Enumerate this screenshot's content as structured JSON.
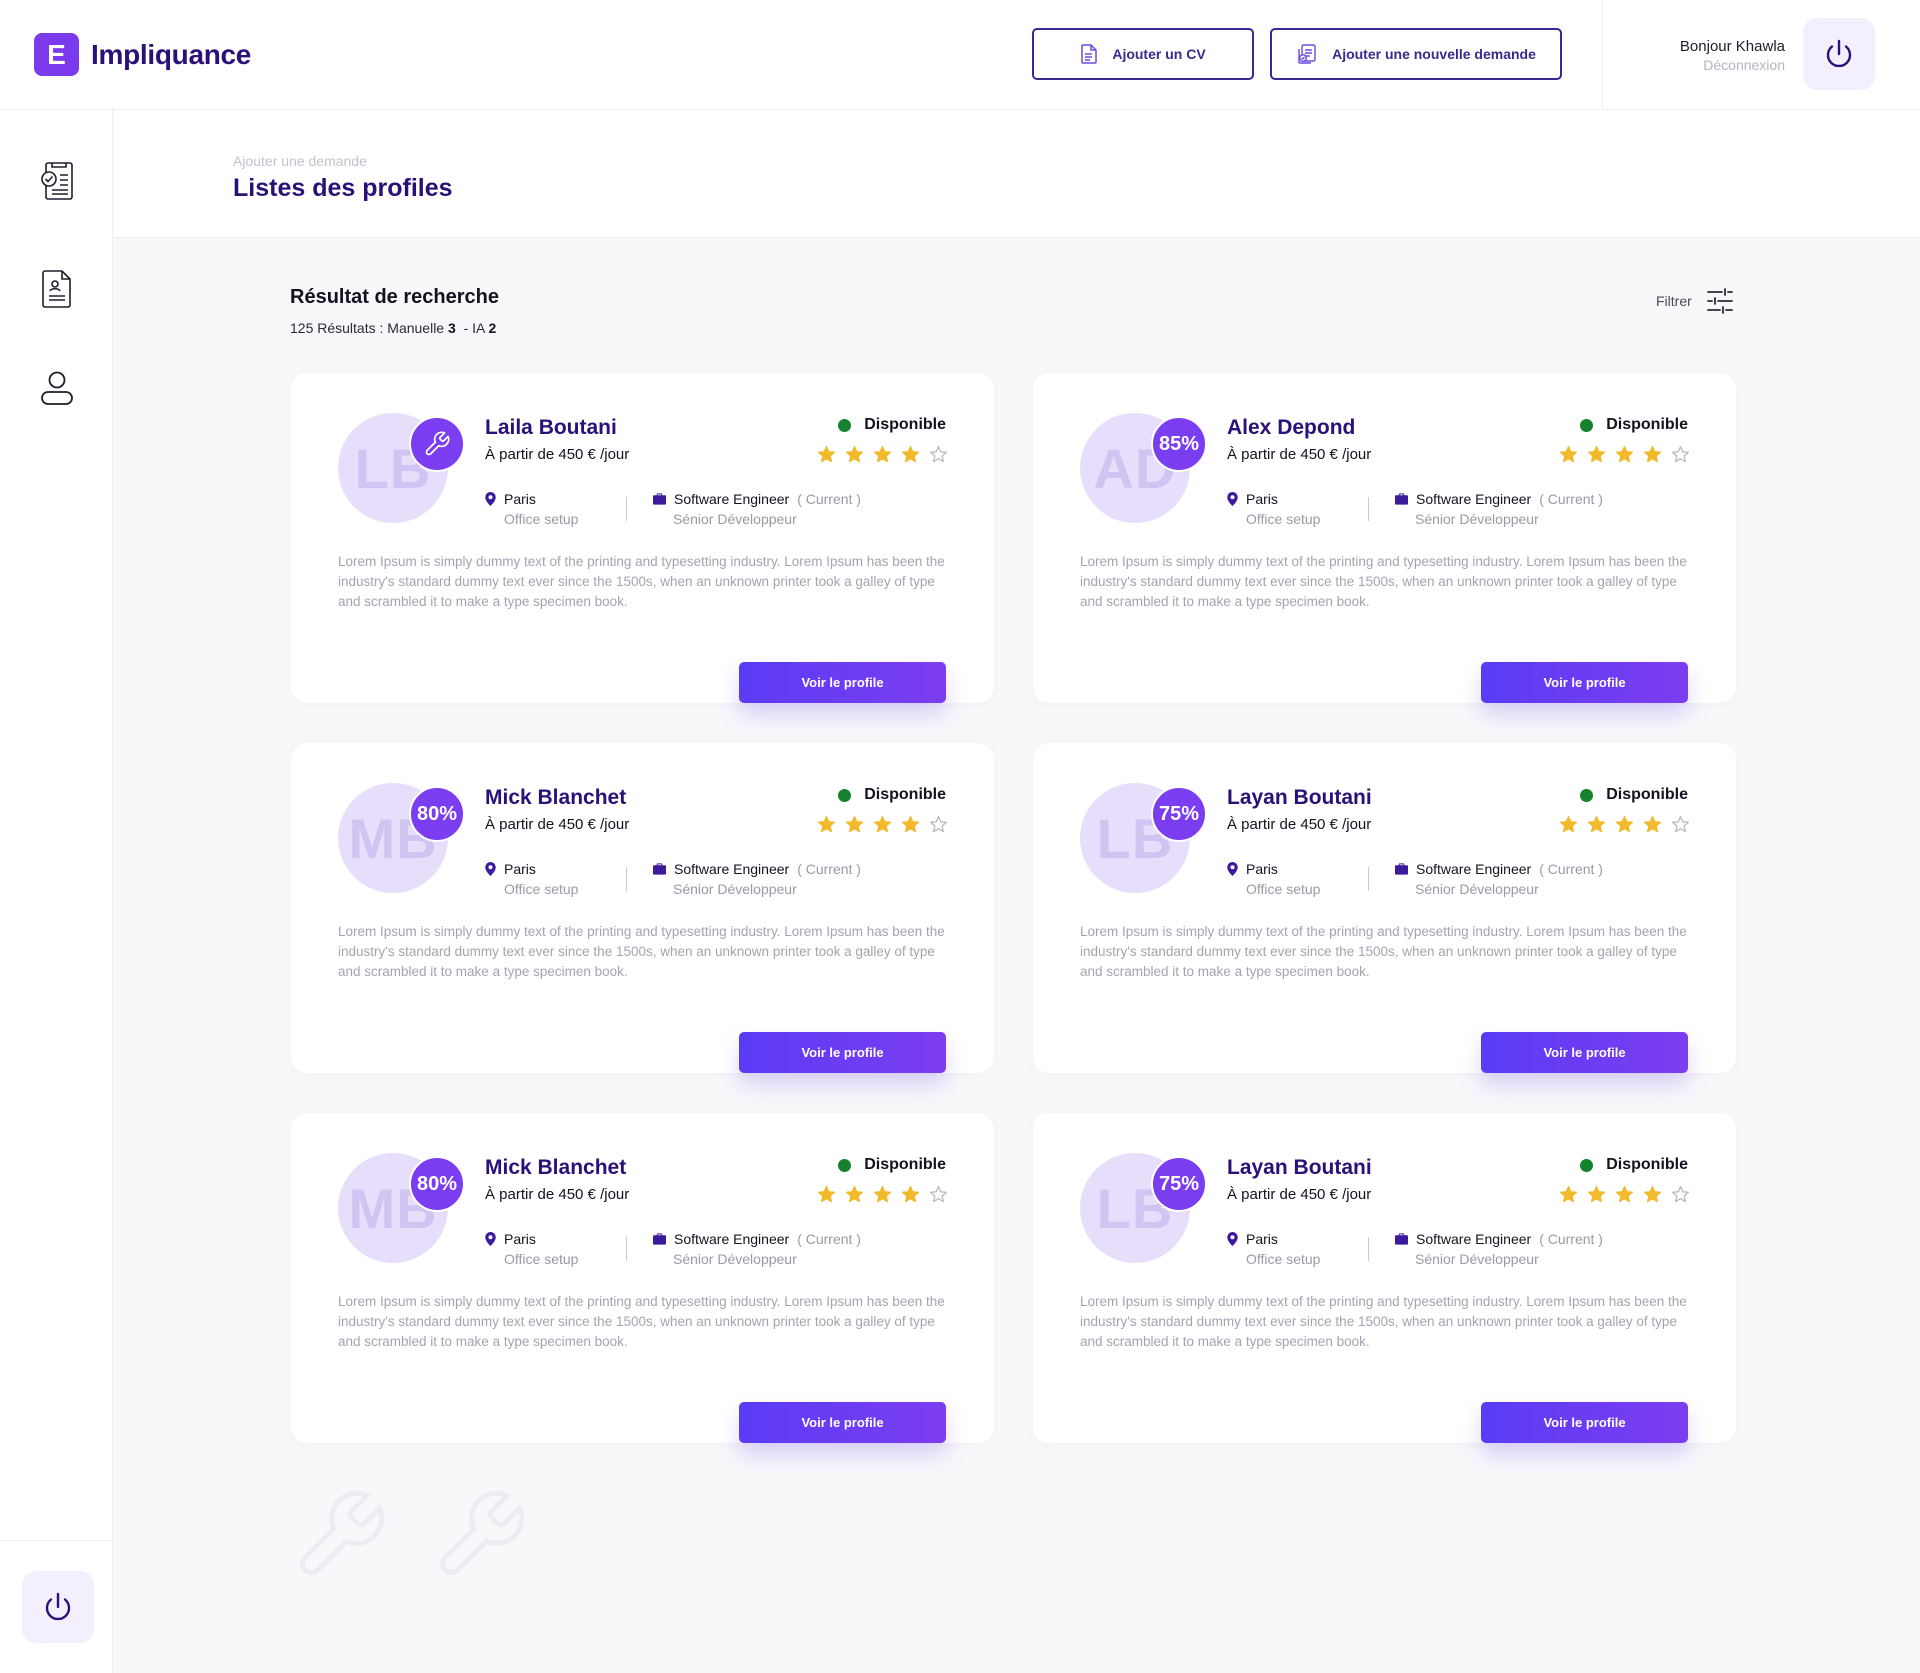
{
  "app": {
    "logo_letter": "E",
    "logo_text": "Impliquance"
  },
  "header": {
    "add_cv_label": "Ajouter un CV",
    "add_request_label": "Ajouter une nouvelle demande",
    "greeting": "Bonjour Khawla",
    "logout_label": "Déconnexion"
  },
  "sidebar": {
    "items": [
      {
        "icon": "checklist-icon"
      },
      {
        "icon": "resume-document-icon"
      },
      {
        "icon": "user-icon"
      }
    ],
    "power_icon": "power-icon"
  },
  "page": {
    "breadcrumb": "Ajouter une demande",
    "title": "Listes des profiles"
  },
  "results": {
    "title": "Résultat de recherche",
    "count_prefix": "125 Résultats : Manuelle",
    "manual_count": "3",
    "ia_prefix": "- IA",
    "ia_count": "2",
    "filter_label": "Filtrer"
  },
  "colors": {
    "brand": "#7c3aed",
    "title": "#2a1078",
    "available": "#16822e",
    "star": "#f2b92b"
  },
  "profiles": [
    {
      "initials": "LB",
      "badge": "",
      "badge_icon": "wrench-icon",
      "name": "Laila Boutani",
      "rate": "À partir de 450 € /jour",
      "status": "Disponible",
      "rating": 4,
      "rating_max": 5,
      "city": "Paris",
      "work_mode": "Office setup",
      "job_title": "Software Engineer",
      "job_current": "( Current )",
      "level": "Sénior Développeur",
      "description": "Lorem Ipsum is simply dummy text of the printing and typesetting industry. Lorem Ipsum has been the industry's standard dummy text ever since the 1500s, when an unknown printer took a galley of type and scrambled it to make a type specimen book.",
      "cta": "Voir le profile"
    },
    {
      "initials": "AD",
      "badge": "85%",
      "badge_icon": "",
      "name": "Alex Depond",
      "rate": "À partir de 450 € /jour",
      "status": "Disponible",
      "rating": 4,
      "rating_max": 5,
      "city": "Paris",
      "work_mode": "Office setup",
      "job_title": "Software Engineer",
      "job_current": "( Current )",
      "level": "Sénior Développeur",
      "description": "Lorem Ipsum is simply dummy text of the printing and typesetting industry. Lorem Ipsum has been the industry's standard dummy text ever since the 1500s, when an unknown printer took a galley of type and scrambled it to make a type specimen book.",
      "cta": "Voir le profile"
    },
    {
      "initials": "MB",
      "badge": "80%",
      "badge_icon": "",
      "name": "Mick Blanchet",
      "rate": "À partir de 450 € /jour",
      "status": "Disponible",
      "rating": 4,
      "rating_max": 5,
      "city": "Paris",
      "work_mode": "Office setup",
      "job_title": "Software Engineer",
      "job_current": "( Current )",
      "level": "Sénior Développeur",
      "description": "Lorem Ipsum is simply dummy text of the printing and typesetting industry. Lorem Ipsum has been the industry's standard dummy text ever since the 1500s, when an unknown printer took a galley of type and scrambled it to make a type specimen book.",
      "cta": "Voir le profile"
    },
    {
      "initials": "LB",
      "badge": "75%",
      "badge_icon": "",
      "name": "Layan Boutani",
      "rate": "À partir de 450 € /jour",
      "status": "Disponible",
      "rating": 4,
      "rating_max": 5,
      "city": "Paris",
      "work_mode": "Office setup",
      "job_title": "Software Engineer",
      "job_current": "( Current )",
      "level": "Sénior Développeur",
      "description": "Lorem Ipsum is simply dummy text of the printing and typesetting industry. Lorem Ipsum has been the industry's standard dummy text ever since the 1500s, when an unknown printer took a galley of type and scrambled it to make a type specimen book.",
      "cta": "Voir le profile"
    },
    {
      "initials": "MB",
      "badge": "80%",
      "badge_icon": "",
      "name": "Mick Blanchet",
      "rate": "À partir de 450 € /jour",
      "status": "Disponible",
      "rating": 4,
      "rating_max": 5,
      "city": "Paris",
      "work_mode": "Office setup",
      "job_title": "Software Engineer",
      "job_current": "( Current )",
      "level": "Sénior Développeur",
      "description": "Lorem Ipsum is simply dummy text of the printing and typesetting industry. Lorem Ipsum has been the industry's standard dummy text ever since the 1500s, when an unknown printer took a galley of type and scrambled it to make a type specimen book.",
      "cta": "Voir le profile"
    },
    {
      "initials": "LB",
      "badge": "75%",
      "badge_icon": "",
      "name": "Layan Boutani",
      "rate": "À partir de 450 € /jour",
      "status": "Disponible",
      "rating": 4,
      "rating_max": 5,
      "city": "Paris",
      "work_mode": "Office setup",
      "job_title": "Software Engineer",
      "job_current": "( Current )",
      "level": "Sénior Développeur",
      "description": "Lorem Ipsum is simply dummy text of the printing and typesetting industry. Lorem Ipsum has been the industry's standard dummy text ever since the 1500s, when an unknown printer took a galley of type and scrambled it to make a type specimen book.",
      "cta": "Voir le profile"
    }
  ]
}
